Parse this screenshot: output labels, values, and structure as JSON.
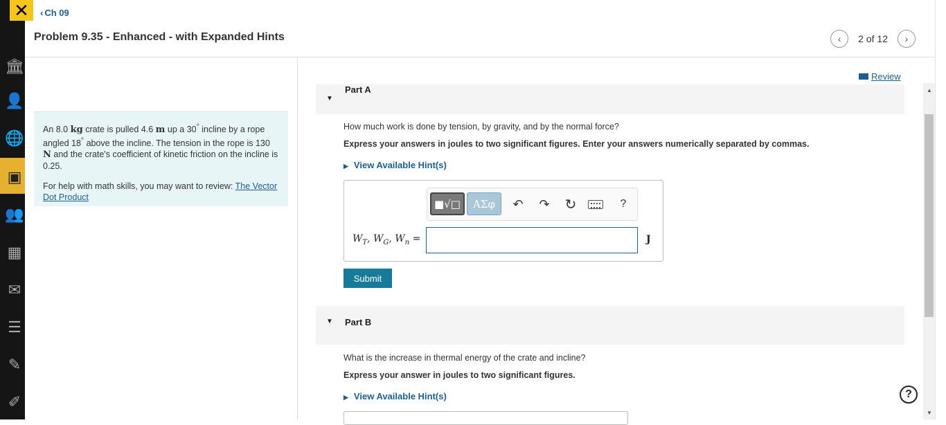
{
  "header": {
    "breadcrumb": "Ch 09",
    "title": "Problem 9.35 - Enhanced - with Expanded Hints",
    "pagination": "2 of 12"
  },
  "rail_icons": [
    "close-icon",
    "institution-icon",
    "user-icon",
    "globe-icon",
    "assignment-icon",
    "people-icon",
    "calendar-icon",
    "mail-icon",
    "gradebook-icon",
    "tools-icon",
    "edit-icon"
  ],
  "problem": {
    "text_parts": [
      "An 8.0 ",
      "kg",
      " crate is pulled 4.6 ",
      "m",
      " up a 30",
      "°",
      " incline by a rope angled 18",
      "°",
      " above the incline. The tension in the rope is 130 ",
      "N",
      " and the crate's coefficient of kinetic friction on the incline is 0.25."
    ],
    "help_text": "For help with math skills, you may want to review: ",
    "help_link": "The Vector Dot Product"
  },
  "review_label": "Review",
  "part_a": {
    "label": "Part A",
    "question": "How much work is done by tension, by gravity, and by the normal force?",
    "instruction": "Express your answers in joules to two significant figures. Enter your answers numerically separated by commas.",
    "hint_label": "View Available Hint(s)",
    "math_label": "W_T, W_G, W_n =",
    "answer_value": "",
    "unit": "J",
    "submit_label": "Submit",
    "toolbar": {
      "template_label": "■√□",
      "greek_label": "ΑΣφ",
      "help_label": "?"
    }
  },
  "part_b": {
    "label": "Part B",
    "question": "What is the increase in thermal energy of the crate and incline?",
    "instruction": "Express your answer in joules to two significant figures.",
    "hint_label": "View Available Hint(s)"
  },
  "colors": {
    "accent": "#1a5f93",
    "submit": "#167a9b",
    "problem_bg": "#e7f5f6",
    "rail_active": "#e6b12e"
  }
}
